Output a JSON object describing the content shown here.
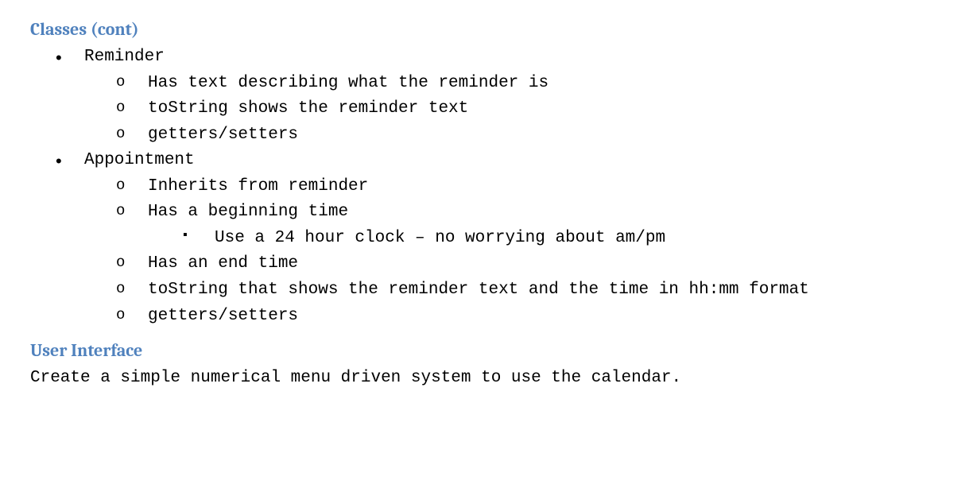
{
  "sections": {
    "classes": {
      "heading": "Classes (cont)",
      "items": {
        "reminder": {
          "label": "Reminder",
          "sub": {
            "a": "Has text describing what the reminder is",
            "b": "toString shows the reminder text",
            "c": "getters/setters"
          }
        },
        "appointment": {
          "label": "Appointment",
          "sub": {
            "a": "Inherits from reminder",
            "b": "Has a beginning time",
            "b_sub": {
              "i": "Use a 24 hour clock – no worrying about am/pm"
            },
            "c": "Has an end time",
            "d": "toString that shows the reminder text and the time in hh:mm format",
            "e": "getters/setters"
          }
        }
      }
    },
    "ui": {
      "heading": "User Interface",
      "body": "Create a simple numerical menu driven system to use the calendar."
    }
  }
}
